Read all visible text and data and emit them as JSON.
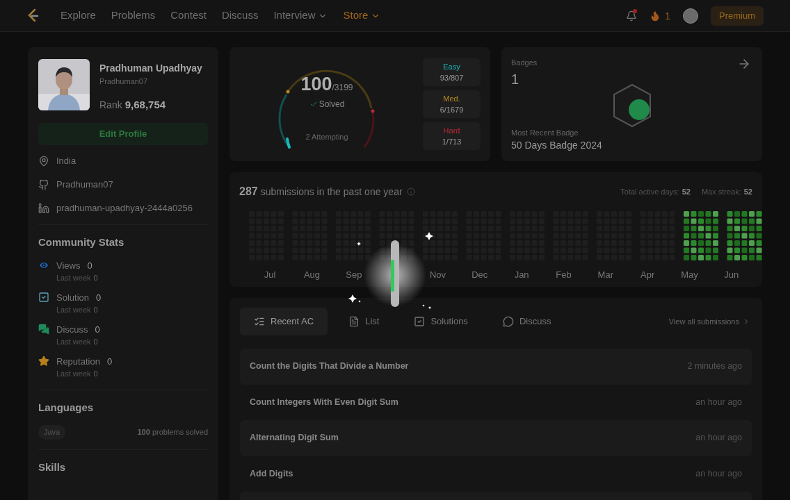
{
  "nav": {
    "items": [
      {
        "label": "Explore",
        "kind": "link",
        "highlighted": false
      },
      {
        "label": "Problems",
        "kind": "link",
        "highlighted": false
      },
      {
        "label": "Contest",
        "kind": "link",
        "highlighted": false
      },
      {
        "label": "Discuss",
        "kind": "link",
        "highlighted": false
      },
      {
        "label": "Interview",
        "kind": "menu",
        "highlighted": false
      },
      {
        "label": "Store",
        "kind": "menu",
        "highlighted": true
      }
    ],
    "notification_unread": true,
    "streak": "1",
    "premium": "Premium"
  },
  "profile": {
    "name": "Pradhuman Upadhyay",
    "username": "Pradhuman07",
    "rank_label": "Rank",
    "rank": "9,68,754",
    "edit_button": "Edit Profile",
    "details": [
      {
        "kind": "location",
        "text": "India"
      },
      {
        "kind": "github",
        "text": "Pradhuman07"
      },
      {
        "kind": "linkedin",
        "text": "pradhuman-upadhyay-2444a0256"
      }
    ]
  },
  "community_stats": {
    "title": "Community Stats",
    "items": [
      {
        "kind": "views",
        "label": "Views",
        "value": "0",
        "sublabel": "Last week",
        "subvalue": "0"
      },
      {
        "kind": "solution",
        "label": "Solution",
        "value": "0",
        "sublabel": "Last week",
        "subvalue": "0"
      },
      {
        "kind": "discuss",
        "label": "Discuss",
        "value": "0",
        "sublabel": "Last week",
        "subvalue": "0"
      },
      {
        "kind": "reputation",
        "label": "Reputation",
        "value": "0",
        "sublabel": "Last week",
        "subvalue": "0"
      }
    ]
  },
  "languages": {
    "title": "Languages",
    "items": [
      {
        "name": "Java",
        "count": "100",
        "suffix": "problems solved"
      }
    ]
  },
  "skills": {
    "title": "Skills"
  },
  "progress": {
    "solved": "100",
    "total": "/3199",
    "solved_label": "Solved",
    "attempting": "2 Attempting",
    "difficulties": [
      {
        "label": "Easy",
        "count": "93/807",
        "color": "#1cb8b8"
      },
      {
        "label": "Med.",
        "count": "6/1679",
        "color": "#b88a1c"
      },
      {
        "label": "Hard",
        "count": "1/713",
        "color": "#b82a36"
      }
    ]
  },
  "badges": {
    "title": "Badges",
    "count": "1",
    "recent_label": "Most Recent Badge",
    "recent_name": "50 Days Badge 2024"
  },
  "submissions": {
    "count": "287",
    "text": "submissions in the past one year",
    "stats": [
      {
        "label": "Total active days:",
        "value": "52"
      },
      {
        "label": "Max streak:",
        "value": "52"
      }
    ],
    "months": [
      {
        "kind": "label",
        "label": "Jul"
      },
      {
        "kind": "label",
        "label": "Aug"
      },
      {
        "kind": "label",
        "label": "Sep"
      },
      {
        "kind": "covered"
      },
      {
        "kind": "label",
        "label": "Nov"
      },
      {
        "kind": "label",
        "label": "Dec"
      },
      {
        "kind": "label",
        "label": "Jan"
      },
      {
        "kind": "label",
        "label": "Feb"
      },
      {
        "kind": "label",
        "label": "Mar"
      },
      {
        "kind": "label",
        "label": "Apr"
      },
      {
        "kind": "label",
        "label": "May"
      },
      {
        "kind": "label",
        "label": "Jun"
      }
    ]
  },
  "recent": {
    "tabs": [
      {
        "kind": "recent",
        "label": "Recent AC",
        "selected": true
      },
      {
        "kind": "list",
        "label": "List",
        "selected": false
      },
      {
        "kind": "solutions",
        "label": "Solutions",
        "selected": false
      },
      {
        "kind": "discuss",
        "label": "Discuss",
        "selected": false
      }
    ],
    "view_all": "View all submissions",
    "rows": [
      {
        "title": "Count the Digits That Divide a Number",
        "time": "2 minutes ago"
      },
      {
        "title": "Count Integers With Even Digit Sum",
        "time": "an hour ago"
      },
      {
        "title": "Alternating Digit Sum",
        "time": "an hour ago"
      },
      {
        "title": "Add Digits",
        "time": "an hour ago"
      }
    ]
  }
}
